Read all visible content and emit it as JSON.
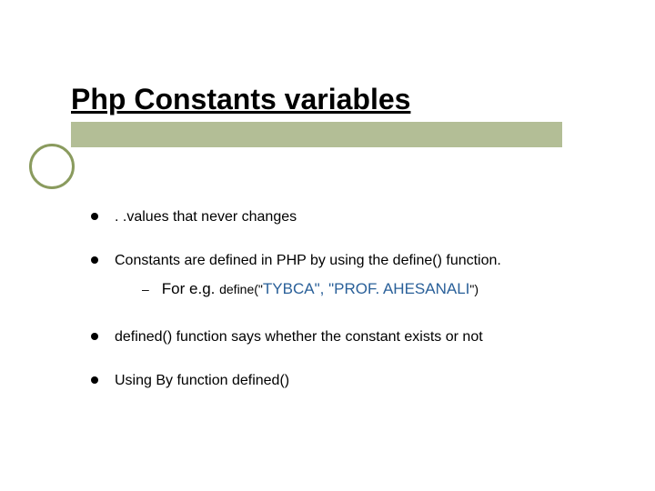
{
  "title": "Php Constants variables",
  "bullets": {
    "b1": ". .values that never changes",
    "b2": "Constants are defined in PHP by using the define() function.",
    "b2_sub_prefix": "For e.g. ",
    "b2_sub_define_open": "define(",
    "b2_sub_q1": "\"",
    "b2_sub_arg1": "TYBCA\", \"PROF. AHESANALI",
    "b2_sub_q2": "\"",
    "b2_sub_define_close": ")",
    "b3": "defined() function says whether the constant exists or not",
    "b4": "Using By function defined()"
  },
  "dash": "–"
}
